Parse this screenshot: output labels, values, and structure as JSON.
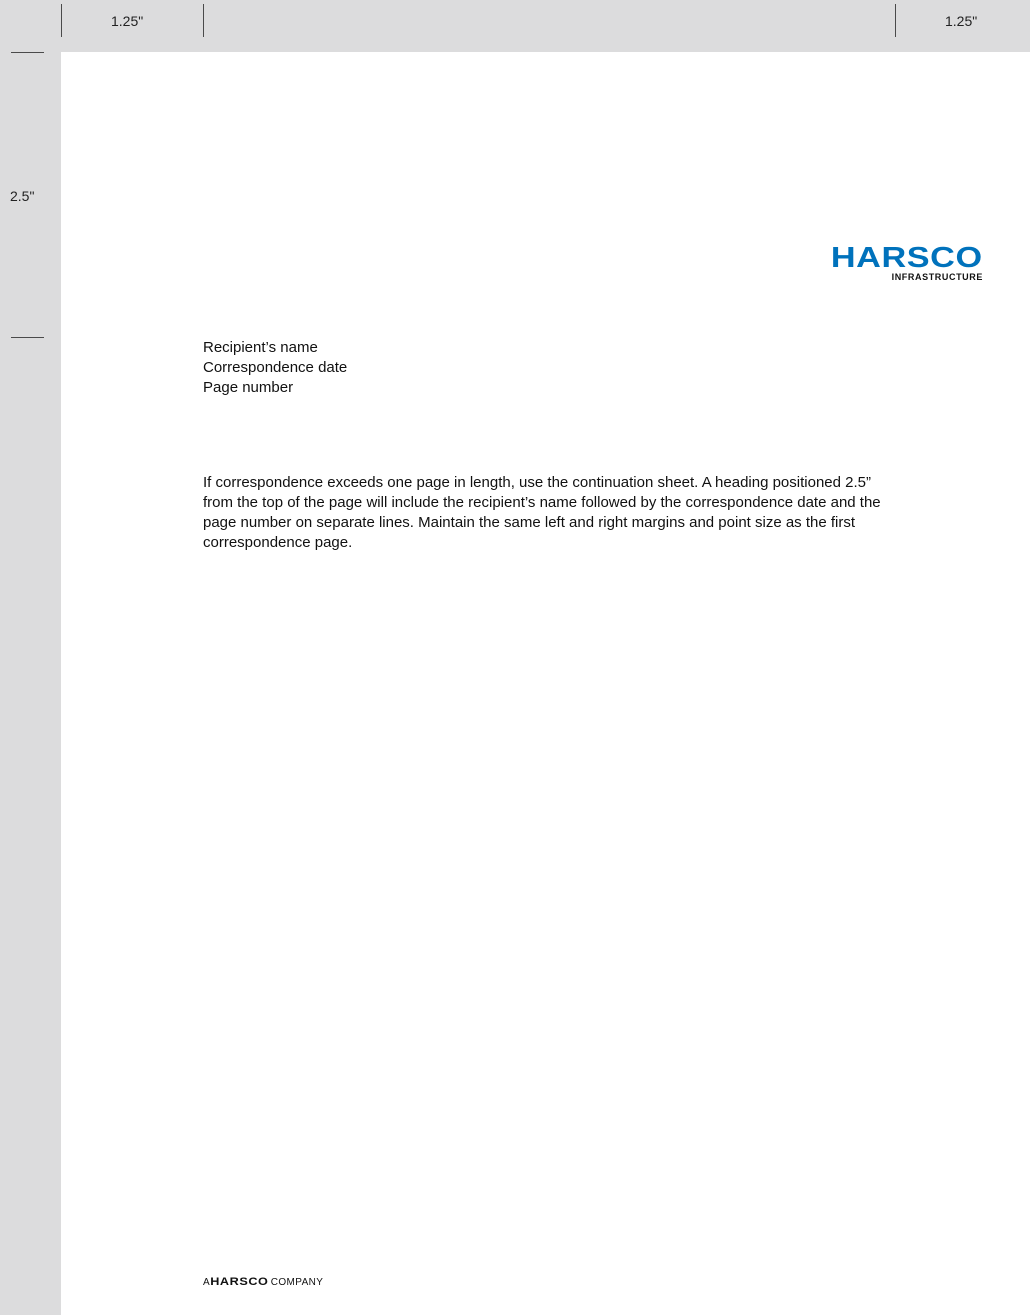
{
  "rulers": {
    "left_margin_label": "1.25\"",
    "right_margin_label": "1.25\"",
    "top_margin_label": "2.5\""
  },
  "logo": {
    "wordmark": "HARSCO",
    "subtitle": "INFRASTRUCTURE",
    "brand_color": "#0072bc"
  },
  "heading": {
    "recipient": "Recipient’s name",
    "date": "Correspondence date",
    "page_number": "Page number"
  },
  "body": {
    "paragraph": "If correspondence exceeds one page in length, use the continuation sheet. A heading positioned 2.5” from the top of the page will include the recipient’s name followed by the correspondence date and the page number on separate lines. Maintain the same left and right margins and point size as the first correspondence page."
  },
  "footer": {
    "prefix": "A",
    "brand": "HARSCO",
    "suffix": "COMPANY"
  }
}
